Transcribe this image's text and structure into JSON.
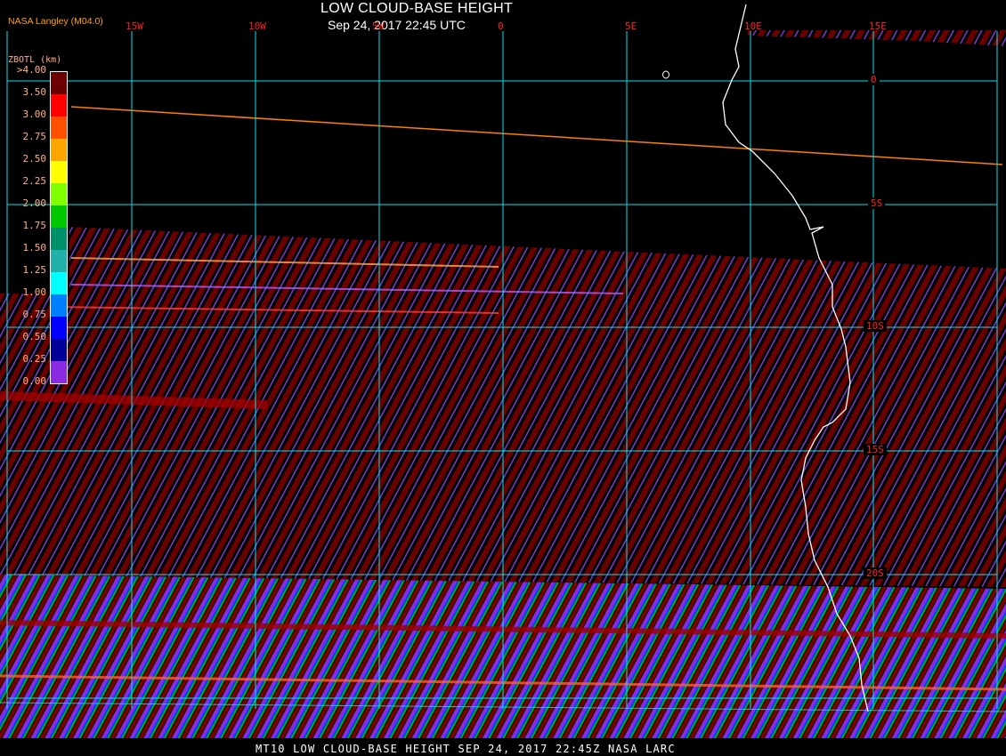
{
  "header": {
    "title": "LOW CLOUD-BASE HEIGHT",
    "datetime": "Sep 24, 2017 22:45 UTC",
    "credit": "NASA Langley (M04.0)"
  },
  "map": {
    "longitude_labels": [
      "15W",
      "10W",
      "5W",
      "0",
      "5E",
      "10E",
      "15E"
    ],
    "latitude_labels": [
      "0",
      "5S",
      "10S",
      "15S",
      "20S"
    ],
    "grid_color": "#00e5ee",
    "coastline_color": "#ffffff",
    "label_color": "#ff2020"
  },
  "legend": {
    "title": "ZBOTL (km)",
    "labels": [
      ">4.00",
      "3.50",
      "3.00",
      "2.75",
      "2.50",
      "2.25",
      "2.00",
      "1.75",
      "1.50",
      "1.25",
      "1.00",
      "0.75",
      "0.50",
      "0.25",
      "0.00"
    ],
    "colors": [
      "#6b0000",
      "#ff0000",
      "#ff5000",
      "#ffa500",
      "#ffff00",
      "#80ff00",
      "#00c800",
      "#00906a",
      "#20b2aa",
      "#00ffff",
      "#0080ff",
      "#0000ff",
      "#000096",
      "#8a2be2"
    ]
  },
  "footer": {
    "text": "MT10  LOW CLOUD-BASE HEIGHT   SEP 24, 2017 22:45Z   NASA LARC"
  }
}
